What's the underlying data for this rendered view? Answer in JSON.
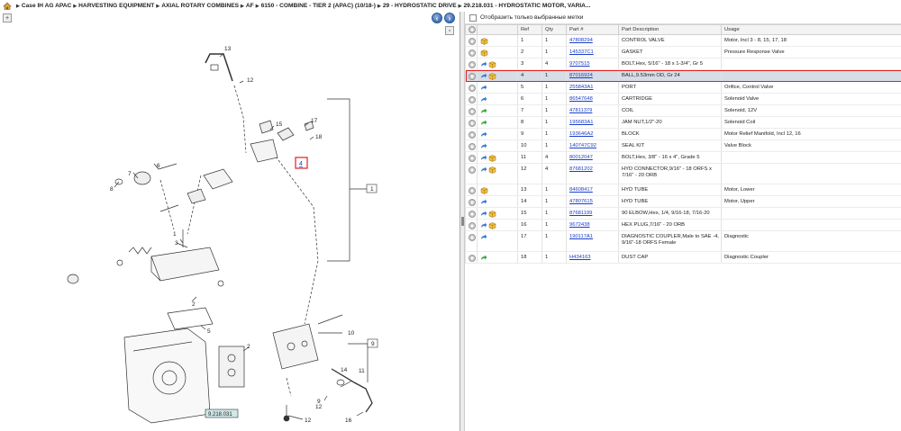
{
  "breadcrumb": [
    "Case IH AG APAC",
    "HARVESTING EQUIPMENT",
    "AXIAL ROTARY COMBINES",
    "AF",
    "6150 - COMBINE - TIER 2 (APAC) (10/18-)",
    "29 - HYDROSTATIC DRIVE",
    "29.218.031 - HYDROSTATIC MOTOR, VARIA..."
  ],
  "toolbar": {
    "show_selected_label": "Отобразить только выбранные метки"
  },
  "diagram": {
    "callouts": [
      "13",
      "12",
      "15",
      "17",
      "18",
      "7",
      "6",
      "8",
      "2",
      "1",
      "3",
      "5",
      "2",
      "10",
      "11",
      "9",
      "12",
      "12",
      "16",
      "14"
    ],
    "highlight_label": "4",
    "ref_label": "9.218.031"
  },
  "table": {
    "headers": [
      "",
      "",
      "Ref",
      "Qty",
      "Part #",
      "Part Description",
      "Usage"
    ],
    "rows": [
      {
        "ref": "1",
        "qty": "1",
        "part": "47808294",
        "desc": "CONTROL VALVE",
        "usage": "Motor, Incl 3 - 8, 15, 17, 18",
        "icons": [
          "box"
        ]
      },
      {
        "ref": "2",
        "qty": "1",
        "part": "145337C1",
        "desc": "GASKET",
        "usage": "Pressure Response Valve",
        "icons": [
          "box"
        ]
      },
      {
        "ref": "3",
        "qty": "4",
        "part": "9707515",
        "desc": "BOLT,Hex, 5/16\" - 18  x 1-3/4\", Gr 5",
        "usage": "",
        "icons": [
          "arrow",
          "box"
        ]
      },
      {
        "ref": "4",
        "qty": "1",
        "part": "87016924",
        "desc": "BALL,9.53mm OD, Gr 24",
        "usage": "",
        "icons": [
          "arrow",
          "box"
        ]
      },
      {
        "ref": "5",
        "qty": "1",
        "part": "255843A1",
        "desc": "PORT",
        "usage": "Orifice, Control Valve",
        "icons": [
          "arrow"
        ]
      },
      {
        "ref": "6",
        "qty": "1",
        "part": "86547648",
        "desc": "CARTRIDGE",
        "usage": "Solenoid Valve",
        "icons": [
          "arrow"
        ]
      },
      {
        "ref": "7",
        "qty": "1",
        "part": "47811379",
        "desc": "COIL",
        "usage": "Solenoid, 12V",
        "icons": [
          "green"
        ]
      },
      {
        "ref": "8",
        "qty": "1",
        "part": "195683A1",
        "desc": "JAM NUT,1/2\"-20",
        "usage": "Solenoid Coil",
        "icons": [
          "green"
        ]
      },
      {
        "ref": "9",
        "qty": "1",
        "part": "193646A2",
        "desc": "BLOCK",
        "usage": "Motor Relief Manifold, Incl 12, 16",
        "icons": [
          "arrow"
        ]
      },
      {
        "ref": "10",
        "qty": "1",
        "part": "140747C92",
        "desc": "SEAL KIT",
        "usage": "Valve Block",
        "icons": [
          "arrow"
        ]
      },
      {
        "ref": "11",
        "qty": "4",
        "part": "80012047",
        "desc": "BOLT,Hex, 3/8\" - 16 x 4\", Grade 5",
        "usage": "",
        "icons": [
          "arrow",
          "box"
        ]
      },
      {
        "ref": "12",
        "qty": "4",
        "part": "87681202",
        "desc": "HYD CONNECTOR,9/16\" - 18 ORFS x 7/16\" - 20 ORB",
        "usage": "",
        "icons": [
          "arrow",
          "box"
        ]
      },
      {
        "ref": "13",
        "qty": "1",
        "part": "84608417",
        "desc": "HYD TUBE",
        "usage": "Motor, Lower",
        "icons": [
          "box"
        ]
      },
      {
        "ref": "14",
        "qty": "1",
        "part": "47807615",
        "desc": "HYD TUBE",
        "usage": "Motor, Upper",
        "icons": [
          "arrow"
        ]
      },
      {
        "ref": "15",
        "qty": "1",
        "part": "87681199",
        "desc": "90 ELBOW,Hex, 1/4, 9/16-18, 7/16-20",
        "usage": "",
        "icons": [
          "arrow",
          "box"
        ]
      },
      {
        "ref": "16",
        "qty": "1",
        "part": "9672438",
        "desc": "HEX PLUG,7/16\" - 20 ORB",
        "usage": "",
        "icons": [
          "arrow",
          "box"
        ]
      },
      {
        "ref": "17",
        "qty": "1",
        "part": "190117A1",
        "desc": "DIAGNOSTIC COUPLER,Male to SAE -4, 9/16\"-18 ORFS Female",
        "usage": "Diagnostic",
        "icons": [
          "arrow"
        ]
      },
      {
        "ref": "18",
        "qty": "1",
        "part": "H434163",
        "desc": "DUST CAP",
        "usage": "Diagnostic Coupler",
        "icons": [
          "green"
        ]
      }
    ]
  },
  "selected_ref": "4"
}
